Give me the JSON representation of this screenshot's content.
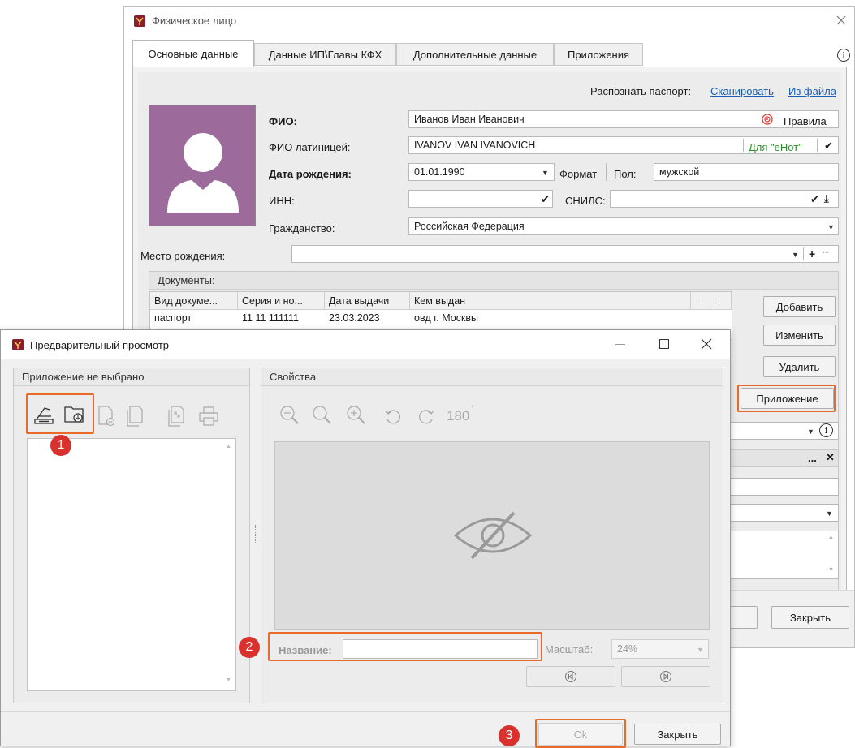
{
  "back_window": {
    "title": "Физическое лицо",
    "tabs": [
      "Основные данные",
      "Данные ИП\\Главы КФХ",
      "Дополнительные данные",
      "Приложения"
    ],
    "recognize_label": "Распознать паспорт:",
    "scan_link": "Сканировать",
    "file_link": "Из файла",
    "fio_label": "ФИО:",
    "fio_value": "Иванов Иван Иванович",
    "rules_label": "Правила",
    "fio_latin_label": "ФИО латиницей:",
    "fio_latin_value": "IVANOV IVAN IVANOVICH",
    "enot_label": "Для \"еНот\"",
    "birth_label": "Дата рождения:",
    "birth_value": "01.01.1990",
    "format_label": "Формат",
    "gender_label": "Пол:",
    "gender_value": "мужской",
    "inn_label": "ИНН:",
    "inn_value": "",
    "snils_label": "СНИЛС:",
    "snils_value": "",
    "citizenship_label": "Гражданство:",
    "citizenship_value": "Российская Федерация",
    "birthplace_label": "Место рождения:",
    "birthplace_value": "",
    "documents_title": "Документы:",
    "doc_columns": [
      "Вид докуме...",
      "Серия и но...",
      "Дата выдачи",
      "Кем выдан",
      "...",
      "..."
    ],
    "doc_rows": [
      {
        "type": "паспорт",
        "series": "11 11 111111",
        "date": "23.03.2023",
        "issuer": "овд г. Москвы"
      }
    ],
    "add_button": "Добавить",
    "edit_button": "Изменить",
    "delete_button": "Удалить",
    "attachment_button": "Приложение",
    "close_button": "Закрыть",
    "ellipsis": "..."
  },
  "preview_window": {
    "title": "Предварительный просмотр",
    "left_group_title": "Приложение не выбрано",
    "right_group_title": "Свойства",
    "rotate_180_label": "180",
    "name_label": "Название:",
    "name_value": "",
    "scale_label": "Масштаб:",
    "scale_value": "24%",
    "ok_button": "Ok",
    "close_button": "Закрыть"
  },
  "badges": [
    "1",
    "2",
    "3"
  ],
  "colors": {
    "accent_highlight": "#e86a2b",
    "badge": "#d9322e",
    "avatar_bg": "#9c6b9b",
    "link": "#1a5fb4",
    "enot_green": "#2e8b2e"
  }
}
